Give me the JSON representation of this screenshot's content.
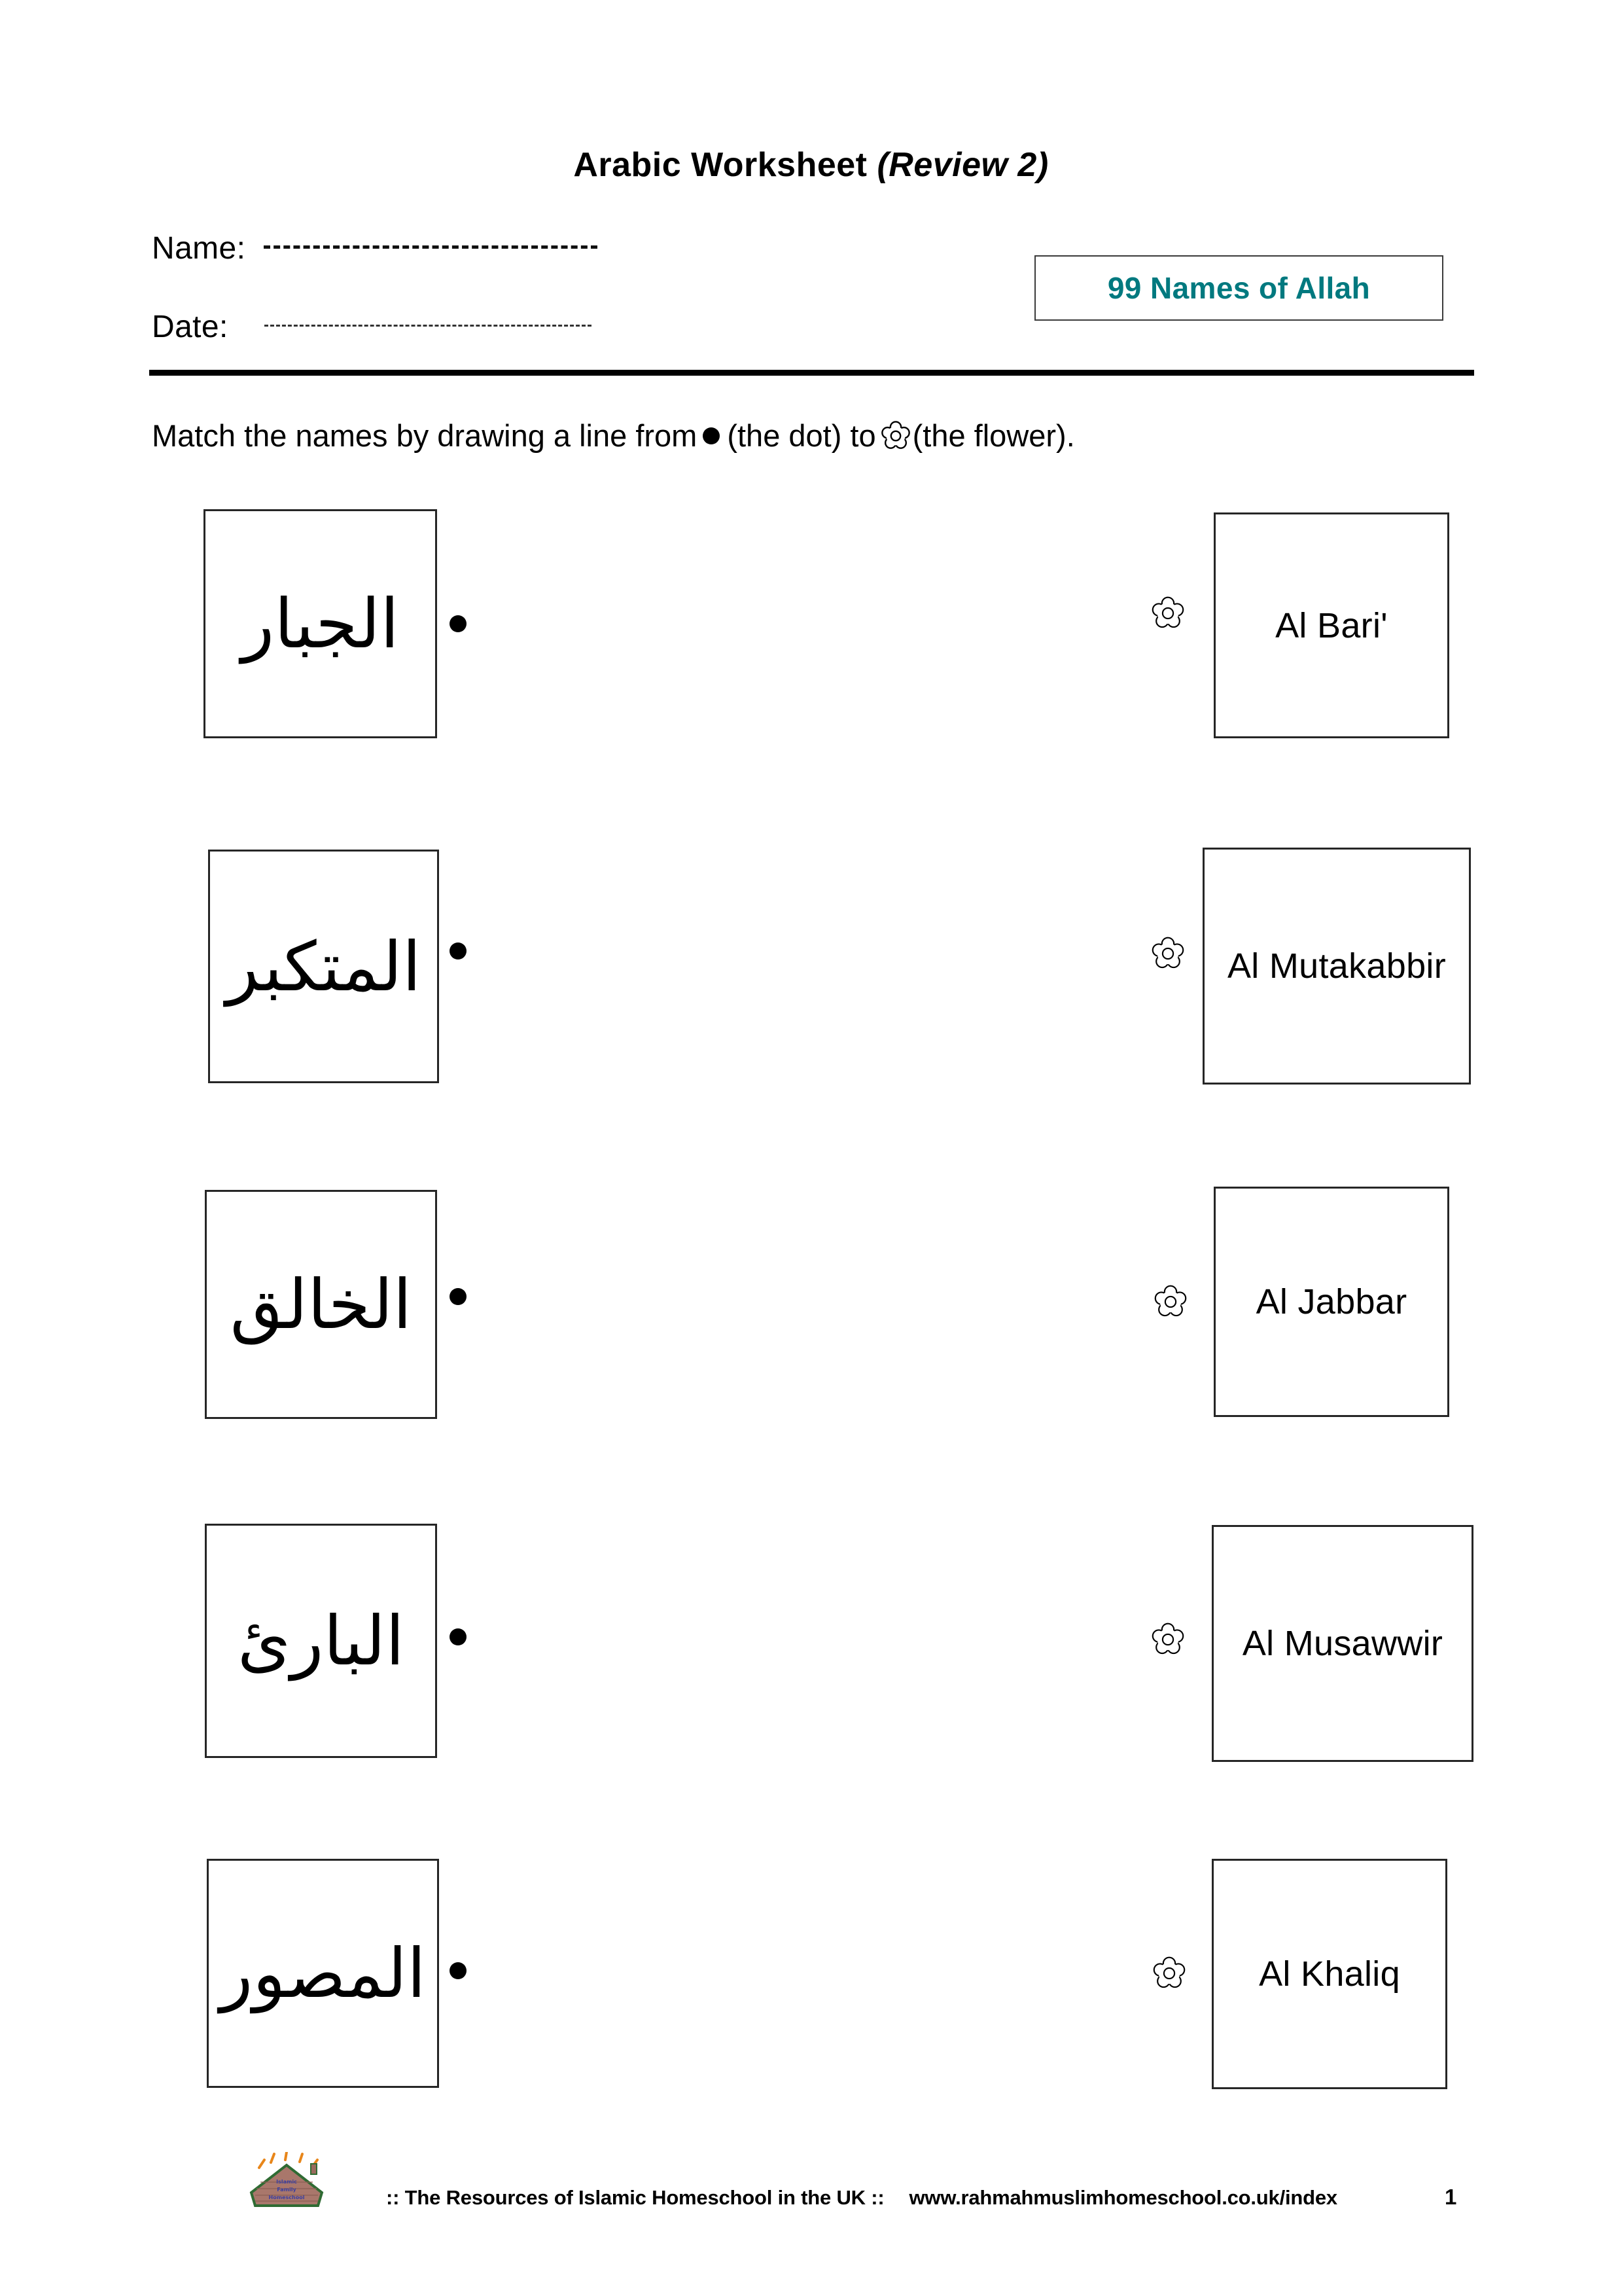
{
  "document": {
    "title_main": "Arabic Worksheet ",
    "title_italic": "(Review 2)"
  },
  "header": {
    "name_label": "Name:",
    "date_label": "Date:",
    "topic_box_label": "99 Names of Allah",
    "topic_box_color": "#00797F"
  },
  "instruction": {
    "part1": "Match the names by drawing a line from",
    "part2": "(the dot) to",
    "part3": "(the flower).",
    "dot_icon": "dot-icon",
    "flower_icon": "flower-icon"
  },
  "match": {
    "arabic_items": [
      {
        "arabic": "الجبار",
        "transliteration": "Al Jabbar"
      },
      {
        "arabic": "المتكبر",
        "transliteration": "Al Mutakabbir"
      },
      {
        "arabic": "الخالق",
        "transliteration": "Al Khaliq"
      },
      {
        "arabic": "البارئ",
        "transliteration": "Al Bari'"
      },
      {
        "arabic": "المصور",
        "transliteration": "Al Musawwir"
      }
    ],
    "english_items": [
      {
        "label": "Al Bari'"
      },
      {
        "label": "Al Mutakabbir"
      },
      {
        "label": "Al Jabbar"
      },
      {
        "label": "Al Musawwir"
      },
      {
        "label": "Al Khaliq"
      }
    ]
  },
  "footer": {
    "tagline": ":: The Resources of Islamic Homeschool in the UK ::",
    "url": "www.rahmahmuslimhomeschool.co.uk/index",
    "page_number": "1",
    "logo_icon": "house-logo-icon"
  }
}
